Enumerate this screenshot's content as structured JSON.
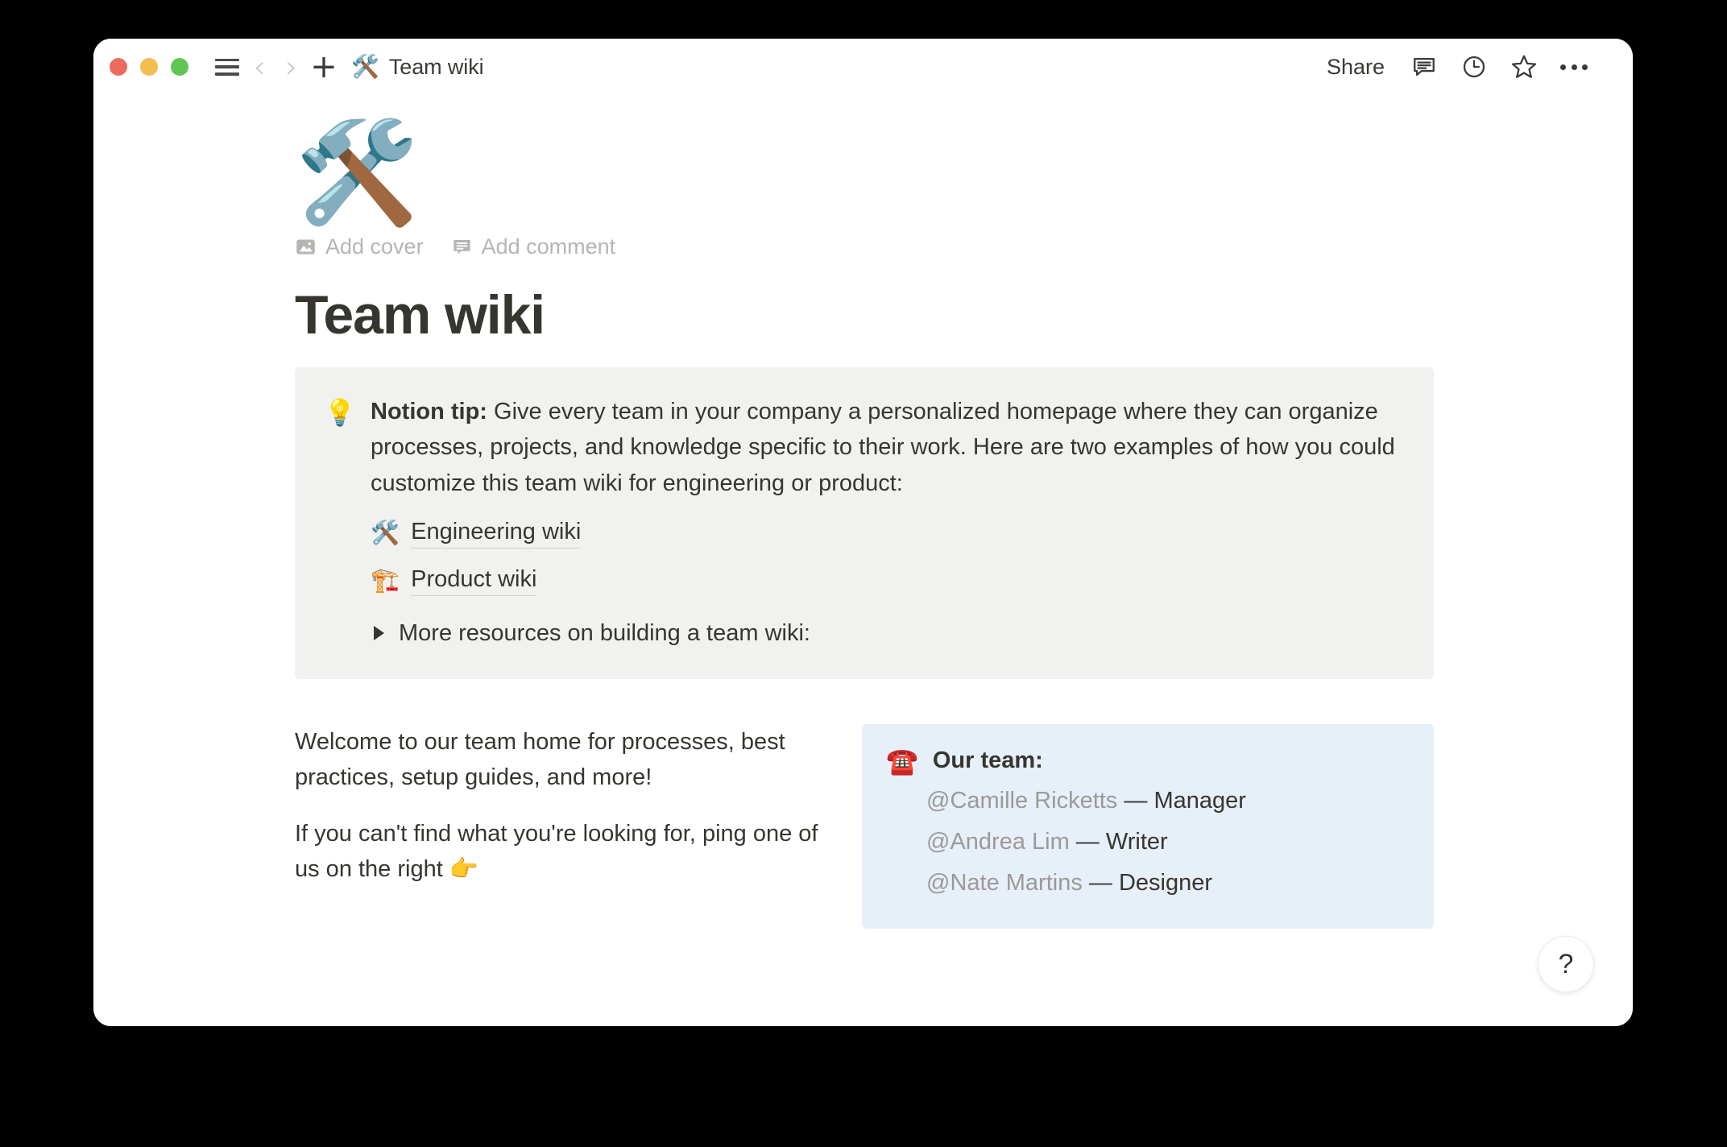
{
  "window": {
    "traffic_lights": [
      {
        "name": "close",
        "color": "#EC6A5E"
      },
      {
        "name": "minimize",
        "color": "#F4BD4F"
      },
      {
        "name": "maximize",
        "color": "#61C554"
      }
    ],
    "background_color": "#000000",
    "surface_color": "#ffffff"
  },
  "titlebar": {
    "sidebar_toggle_icon": "hamburger-menu-icon",
    "back_icon": "chevron-left-icon",
    "forward_icon": "chevron-right-icon",
    "new_page_icon": "plus-icon",
    "breadcrumb": {
      "emoji": "🛠️",
      "label": "Team wiki"
    },
    "share_label": "Share",
    "comment_icon": "comment-bubble-icon",
    "history_icon": "clock-history-icon",
    "favorite_icon": "star-icon",
    "more_icon": "more-horizontal-icon"
  },
  "page": {
    "emoji": "🛠️",
    "actions": [
      {
        "icon": "image-icon",
        "label": "Add cover"
      },
      {
        "icon": "comment-icon",
        "label": "Add comment"
      }
    ],
    "title": "Team wiki",
    "title_color": "#37352F"
  },
  "tip_callout": {
    "background_color": "#F1F1EF",
    "emoji": "💡",
    "lead": "Notion tip:",
    "body": " Give every team in your company a personalized homepage where they can organize processes, projects, and knowledge specific to their work. Here are two examples of how you could customize this team wiki for engineering or product:",
    "links": [
      {
        "emoji": "🛠️",
        "label": "Engineering wiki"
      },
      {
        "emoji": "🏗️",
        "label": "Product wiki"
      }
    ],
    "toggle": {
      "arrow": "collapsed-triangle-icon",
      "label": "More resources on building a team wiki:"
    }
  },
  "body": {
    "paragraphs": [
      "Welcome to our team home for processes, best practices, setup guides, and more!",
      "If you can't find what you're looking for, ping one of us on the right 👉"
    ]
  },
  "team_callout": {
    "background_color": "#E7EFF9",
    "emoji": "☎️",
    "title": "Our team:",
    "members": [
      {
        "mention": "@Camille Ricketts",
        "separator": " — ",
        "role": "Manager"
      },
      {
        "mention": "@Andrea Lim",
        "separator": " — ",
        "role": "Writer"
      },
      {
        "mention": "@Nate Martins",
        "separator": " — ",
        "role": "Designer"
      }
    ]
  },
  "help": {
    "label": "?"
  }
}
